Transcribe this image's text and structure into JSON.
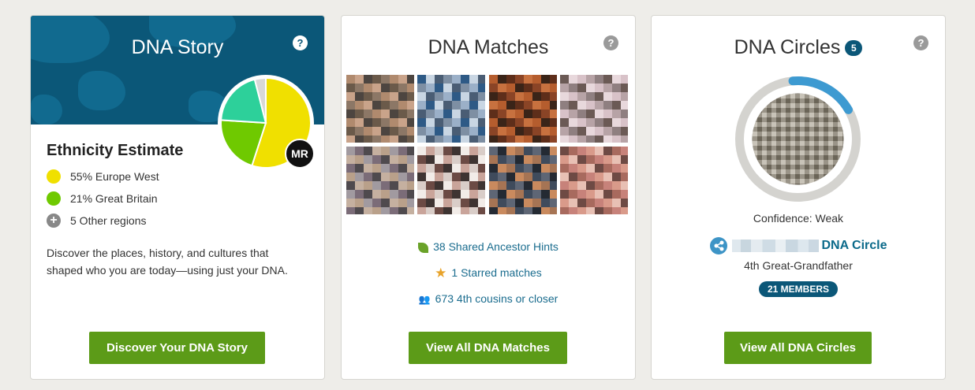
{
  "story": {
    "title": "DNA Story",
    "help": "?",
    "initials": "MR",
    "ethnicity_title": "Ethnicity Estimate",
    "regions": [
      {
        "label": "55% Europe West",
        "color": "#f0e000",
        "value": 55
      },
      {
        "label": "21% Great Britain",
        "color": "#6fc900",
        "value": 21
      },
      {
        "label": "5 Other regions"
      }
    ],
    "pie_other": [
      {
        "color": "#2dd09a",
        "value": 20
      },
      {
        "color": "#d8d8d8",
        "value": 4
      }
    ],
    "description": "Discover the places, history, and cultures that shaped who you are today—using just your DNA.",
    "button": "Discover Your DNA Story"
  },
  "matches": {
    "title": "DNA Matches",
    "help": "?",
    "photos": [
      [
        "#b08a6e",
        "#6b5a4a",
        "#c9a38a",
        "#8c7766",
        "#4d4540"
      ],
      [
        "#9bb0c8",
        "#4a5d74",
        "#2e5a86",
        "#7e8fa3",
        "#c9d6e3"
      ],
      [
        "#8a4426",
        "#3a2418",
        "#c7713f",
        "#5e2e1a",
        "#b55d2e"
      ],
      [
        "#d8c2c8",
        "#6b5a55",
        "#b7a3a6",
        "#e8d8dc",
        "#8f7f80"
      ],
      [
        "#7b6c78",
        "#b9a08a",
        "#4f4a4e",
        "#a19aa0",
        "#c5b0a0"
      ],
      [
        "#f2ece8",
        "#6b4a44",
        "#c9a49a",
        "#3e3432",
        "#d9cdc8"
      ],
      [
        "#3f4b5c",
        "#c98a5e",
        "#5e6675",
        "#a67454",
        "#242a33"
      ],
      [
        "#d99a8a",
        "#a86a5e",
        "#e8c0b4",
        "#c7827a",
        "#6e4a44"
      ]
    ],
    "stats": [
      {
        "icon": "leaf-icon",
        "label": "38 Shared Ancestor Hints"
      },
      {
        "icon": "star-icon",
        "label": "1 Starred matches"
      },
      {
        "icon": "people-icon",
        "label": "673 4th cousins or closer"
      }
    ],
    "button": "View All DNA Matches"
  },
  "circles": {
    "title": "DNA Circles",
    "count": "5",
    "help": "?",
    "confidence_fraction": 0.18,
    "confidence": "Confidence: Weak",
    "circle_name": "DNA Circle",
    "relation": "4th Great-Grandfather",
    "members": "21 MEMBERS",
    "button": "View All DNA Circles"
  }
}
